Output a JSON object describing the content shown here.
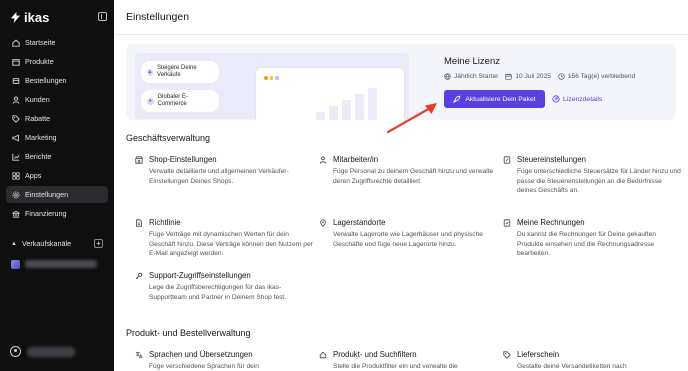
{
  "app": {
    "logo_text": "ikas"
  },
  "sidebar": {
    "items": [
      {
        "label": "Startseite",
        "icon": "home-icon",
        "active": false
      },
      {
        "label": "Produkte",
        "icon": "box-icon",
        "active": false
      },
      {
        "label": "Bestellungen",
        "icon": "cart-icon",
        "active": false
      },
      {
        "label": "Kunden",
        "icon": "users-icon",
        "active": false
      },
      {
        "label": "Rabatte",
        "icon": "tag-icon",
        "active": false
      },
      {
        "label": "Marketing",
        "icon": "megaphone-icon",
        "active": false
      },
      {
        "label": "Berichte",
        "icon": "chart-icon",
        "active": false
      },
      {
        "label": "Apps",
        "icon": "apps-icon",
        "active": false
      },
      {
        "label": "Einstellungen",
        "icon": "gear-icon",
        "active": true
      },
      {
        "label": "Finanzierung",
        "icon": "bank-icon",
        "active": false
      }
    ],
    "sales_channels_label": "Verkaufskanäle"
  },
  "header": {
    "title": "Einstellungen"
  },
  "license": {
    "chip1": "Steigere Deine Verkäufe",
    "chip2": "Globaler E-Commerce",
    "title": "Meine Lizenz",
    "plan": "Jährlich Starter",
    "date": "10 Juli 2025",
    "remaining": "156 Tag(e) verbleibend",
    "cta": "Aktualisiere Dein Paket",
    "link": "Lizenzdetails"
  },
  "sections": [
    {
      "title": "Geschäftsverwaltung",
      "items": [
        {
          "title": "Shop-Einstellungen",
          "icon": "store-icon",
          "desc": "Verwalte detaillierte und allgemeinen Verkäufer-Einstellungen Deines Shops."
        },
        {
          "title": "Mitarbeiter/in",
          "icon": "person-icon",
          "desc": "Füge Personal zu deinem Geschäft hinzu und verwalte deren Zugriffsrechte detailliert."
        },
        {
          "title": "Steuereinstellungen",
          "icon": "receipt-icon",
          "desc": "Füge unterschiedliche Steuersätze für Länder hinzu und passe die Steuereinstellungen an die Bedürfnisse deines Geschäfts an."
        },
        {
          "title": "Richtlinie",
          "icon": "document-icon",
          "desc": "Füge Verträge mit dynamischen Werten für dein Geschäft hinzu. Diese Verträge können den Nutzern per E-Mail angezeigt werden."
        },
        {
          "title": "Lagerstandorte",
          "icon": "location-pin-icon",
          "desc": "Verwalte Lagerorte wie Lagerhäuser und physische Geschäfte und füge neue Lagerorte hinzu."
        },
        {
          "title": "Meine Rechnungen",
          "icon": "invoice-icon",
          "desc": "Du kannst die Rechnungen für Deine gekauften Produkte einsehen und die Rechnungsadresse bearbeiten."
        },
        {
          "title": "Support-Zugriffseinstellungen",
          "icon": "key-icon",
          "desc": "Lege die Zugriffsberechtigungen für das ikas-Supportteam und Partner in Deinem Shop fest."
        }
      ]
    },
    {
      "title": "Produkt- und Bestellverwaltung",
      "items": [
        {
          "title": "Sprachen und Übersetzungen",
          "icon": "translate-icon",
          "desc": "Füge verschiedene Sprachen für dein"
        },
        {
          "title": "Produkt- und Suchfiltern",
          "icon": "filter-icon",
          "desc": "Stelle die Produktfilter ein und verwalte die"
        },
        {
          "title": "Lieferschein",
          "icon": "tag-icon",
          "desc": "Gestalte deine Versandetiketten nach"
        }
      ]
    }
  ],
  "colors": {
    "accent": "#5b3fe0",
    "sidebar_bg": "#0f0f10",
    "arrow": "#e5402f"
  }
}
